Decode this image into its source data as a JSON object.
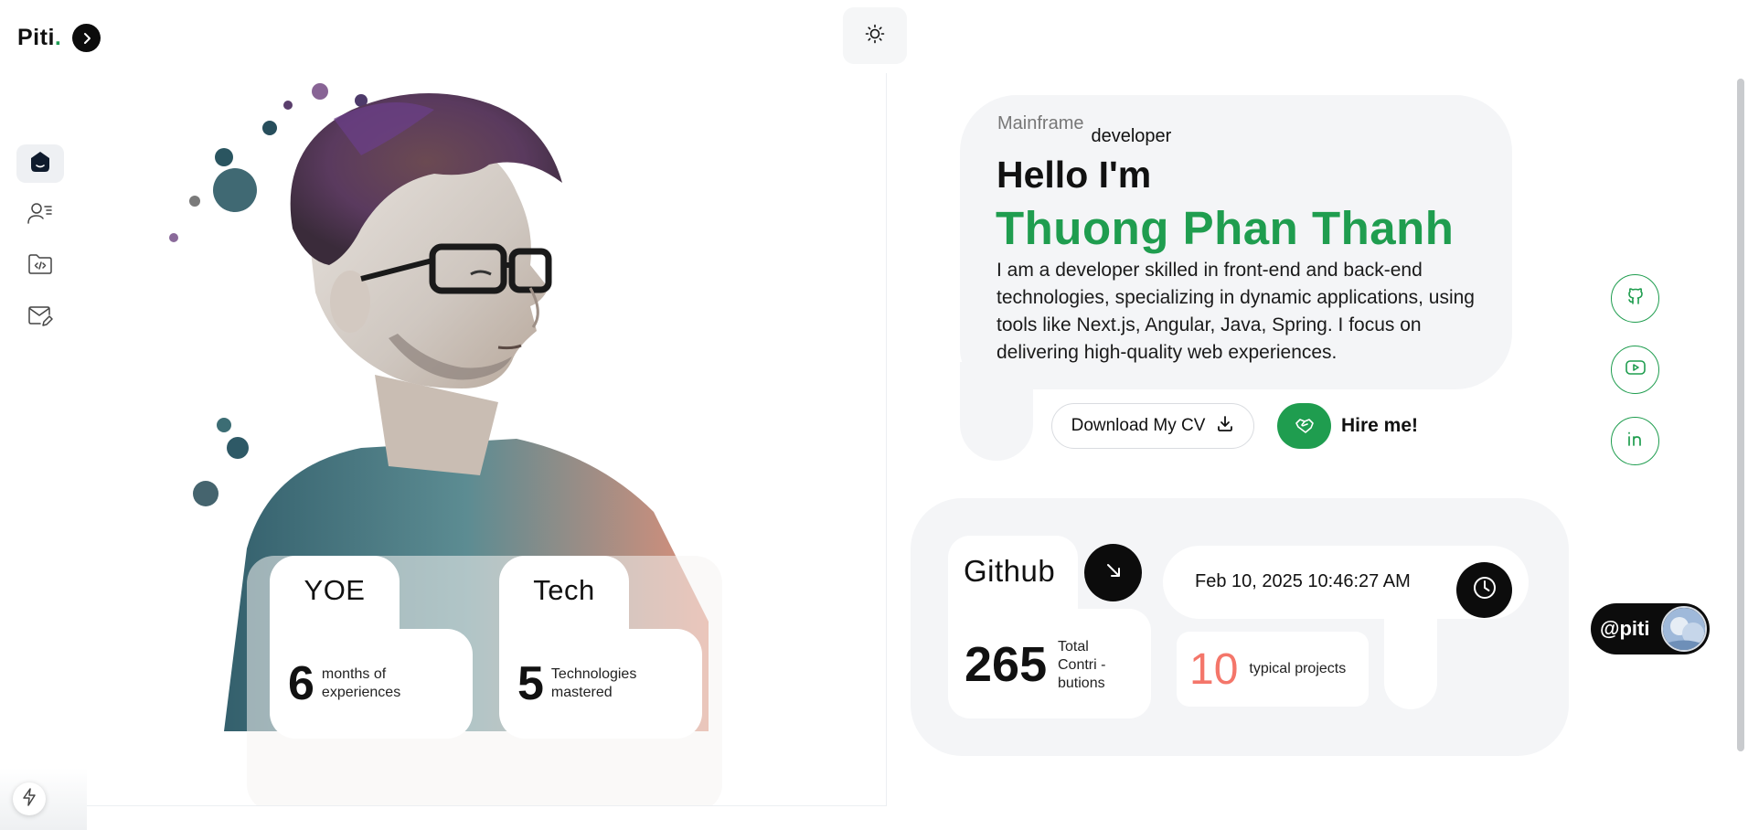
{
  "logo": {
    "text": "Piti",
    "dot": "."
  },
  "theme_toggle": {
    "icon": "sun-icon"
  },
  "sidebar": {
    "items": [
      {
        "icon": "home-icon",
        "active": true
      },
      {
        "icon": "user-profile-icon",
        "active": false
      },
      {
        "icon": "code-folder-icon",
        "active": false
      },
      {
        "icon": "mail-edit-icon",
        "active": false
      }
    ],
    "bottom_button_icon": "bolt-icon"
  },
  "portrait": {
    "stats": [
      {
        "tab": "YOE",
        "value": "6",
        "label_line1": "months of",
        "label_line2": "experiences"
      },
      {
        "tab": "Tech",
        "value": "5",
        "label_line1": "Technologies",
        "label_line2": "mastered"
      }
    ]
  },
  "hero": {
    "role_prefix": "Mainframe",
    "role_suffix": "developer",
    "greeting": "Hello I'm",
    "name": "Thuong Phan Thanh",
    "bio": "I am a developer skilled in front-end and back-end technologies, specializing in dynamic applications, using tools like Next.js, Angular, Java, Spring. I focus on delivering high-quality web experiences.",
    "download_label": "Download My CV",
    "hire_label": "Hire me!"
  },
  "social": [
    {
      "icon": "github-icon"
    },
    {
      "icon": "youtube-icon"
    },
    {
      "icon": "linkedin-icon"
    }
  ],
  "github": {
    "label": "Github",
    "contributions": "265",
    "contrib_line1": "Total",
    "contrib_line2": "Contri -",
    "contrib_line3": "butions"
  },
  "datetime": {
    "text": "Feb 10, 2025 10:46:27 AM"
  },
  "projects": {
    "count": "10",
    "label": "typical projects"
  },
  "handle": {
    "text": "@piti"
  },
  "colors": {
    "accent": "#1f9d4f",
    "project_number": "#f4766a",
    "dark": "#0c0c0c",
    "card_bg": "#f4f5f7"
  }
}
